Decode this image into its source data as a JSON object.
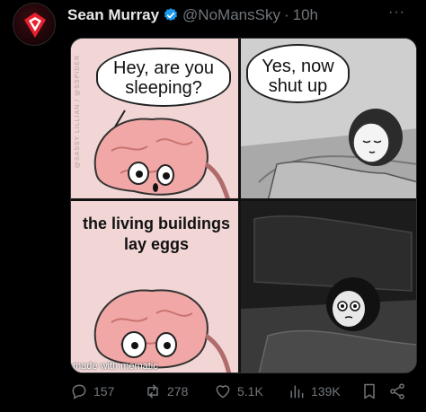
{
  "author": {
    "name": "Sean Murray",
    "handle": "@NoMansSky",
    "separator": "·",
    "time": "10h"
  },
  "more_label": "···",
  "meme": {
    "panel1_text": "Hey, are you sleeping?",
    "panel2_text": "Yes, now shut up",
    "panel3_text": "the living buildings lay eggs",
    "side_watermark": "@SASSY LILLIAN / @SSPIDER",
    "watermark": "made with mematic"
  },
  "stats": {
    "replies": "157",
    "reposts": "278",
    "likes": "5.1K",
    "views": "139K"
  },
  "colors": {
    "background": "#000000",
    "text": "#e7e9ea",
    "muted": "#71767b",
    "verified": "#1d9bf0",
    "avatar_accent": "#e8202e"
  }
}
